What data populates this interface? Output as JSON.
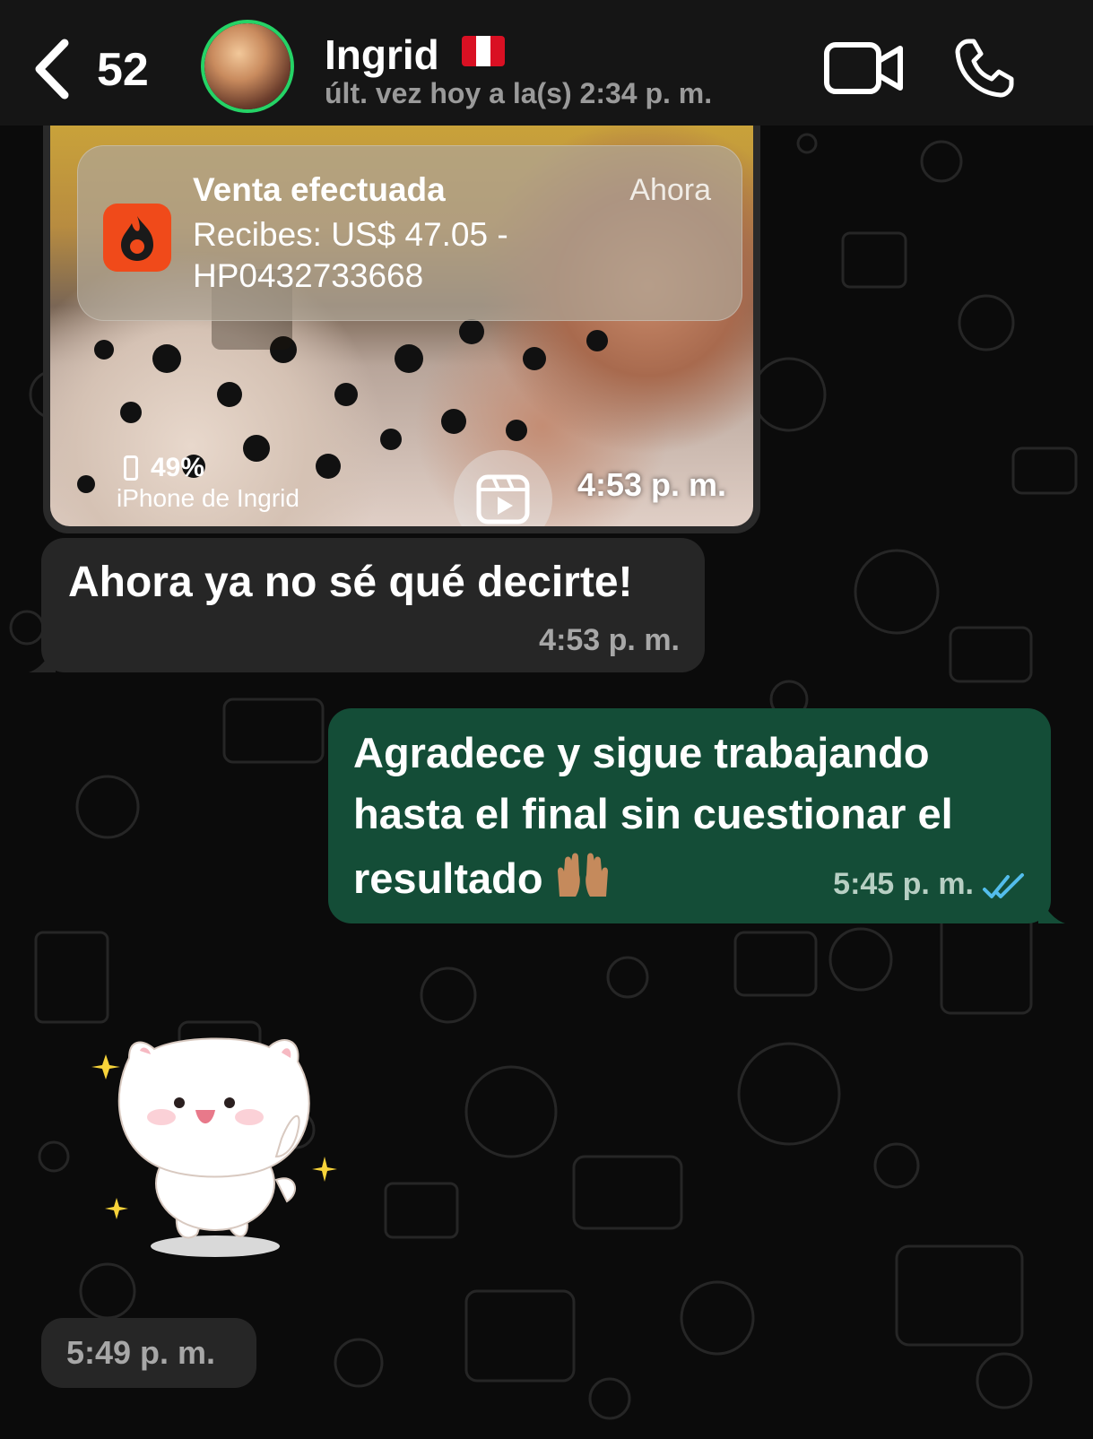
{
  "header": {
    "back_count": "52",
    "contact_name": "Ingrid",
    "flag_icon": "peru-flag-icon",
    "flag_colors": [
      "#d91023",
      "#ffffff",
      "#d91023"
    ],
    "last_seen": "últ. vez hoy a la(s) 2:34 p. m.",
    "icons": [
      "back-chevron-icon",
      "video-camera-icon",
      "phone-icon"
    ],
    "avatar_ring_color": "#25d366"
  },
  "messages": [
    {
      "type": "media",
      "direction": "incoming",
      "notification": {
        "title": "Venta efectuada",
        "time": "Ahora",
        "body_line1": "Recibes: US$ 47.05 -",
        "body_line2": "HP0432733668",
        "app_icon": "hotmart-flame-icon",
        "app_icon_color": "#f04a1a"
      },
      "battery_percent": "49%",
      "device_name": "iPhone de Ingrid",
      "reel_icon": "reel-play-icon",
      "time": "4:53 p. m."
    },
    {
      "type": "text",
      "direction": "incoming",
      "text": "Ahora ya no sé qué decirte!",
      "time": "4:53 p. m."
    },
    {
      "type": "text",
      "direction": "outgoing",
      "lines": [
        "Agradece y sigue trabajando",
        "hasta el final sin cuestionar el",
        "resultado"
      ],
      "emoji": "raising-hands-emoji",
      "time": "5:45 p. m.",
      "status": "read",
      "status_icon": "double-check-icon",
      "status_color": "#53bdeb"
    },
    {
      "type": "sticker",
      "direction": "incoming",
      "sticker": "white-cat-sticker",
      "time": "5:49 p. m."
    }
  ],
  "colors": {
    "incoming_bubble": "#262626",
    "outgoing_bubble": "#144d37",
    "background": "#0b0b0b",
    "header": "#151515"
  }
}
